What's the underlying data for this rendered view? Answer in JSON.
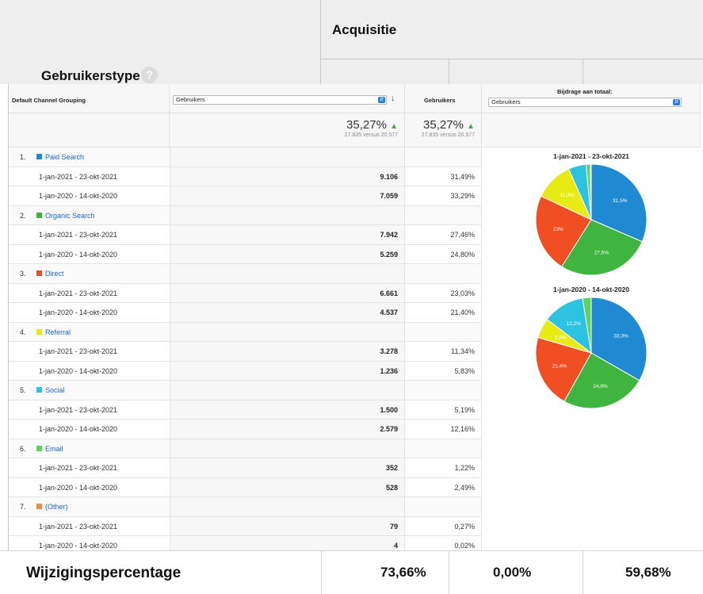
{
  "header": {
    "acquisitie": "Acquisitie",
    "gebruikerstype": "Gebruikerstype",
    "help_icon": "?"
  },
  "table": {
    "col_dimension": "Default Channel Grouping",
    "col_metric_select": "Gebruikers",
    "col_metric_header": "Gebruikers",
    "contribution_label": "Bijdrage aan totaal:",
    "contribution_select": "Gebruikers",
    "summary": [
      {
        "pct": "35,27%",
        "sub": "27.835 versus 20.577"
      },
      {
        "pct": "35,27%",
        "sub": "27.835 versus 20.577"
      }
    ],
    "groups": [
      {
        "num": "1.",
        "name": "Paid Search",
        "color": "#1f8ad1",
        "rows": [
          {
            "date": "1-jan-2021 - 23-okt-2021",
            "value": "9.106",
            "pct": "31,49%"
          },
          {
            "date": "1-jan-2020 - 14-okt-2020",
            "value": "7.059",
            "pct": "33,29%"
          }
        ]
      },
      {
        "num": "2.",
        "name": "Organic Search",
        "color": "#3fb53f",
        "rows": [
          {
            "date": "1-jan-2021 - 23-okt-2021",
            "value": "7.942",
            "pct": "27,46%"
          },
          {
            "date": "1-jan-2020 - 14-okt-2020",
            "value": "5.259",
            "pct": "24,80%"
          }
        ]
      },
      {
        "num": "3.",
        "name": "Direct",
        "color": "#f04e23",
        "rows": [
          {
            "date": "1-jan-2021 - 23-okt-2021",
            "value": "6.661",
            "pct": "23,03%"
          },
          {
            "date": "1-jan-2020 - 14-okt-2020",
            "value": "4.537",
            "pct": "21,40%"
          }
        ]
      },
      {
        "num": "4.",
        "name": "Referral",
        "color": "#e8ea13",
        "rows": [
          {
            "date": "1-jan-2021 - 23-okt-2021",
            "value": "3.278",
            "pct": "11,34%"
          },
          {
            "date": "1-jan-2020 - 14-okt-2020",
            "value": "1.236",
            "pct": "5,83%"
          }
        ]
      },
      {
        "num": "5.",
        "name": "Social",
        "color": "#2dc3e0",
        "rows": [
          {
            "date": "1-jan-2021 - 23-okt-2021",
            "value": "1.500",
            "pct": "5,19%"
          },
          {
            "date": "1-jan-2020 - 14-okt-2020",
            "value": "2.579",
            "pct": "12,16%"
          }
        ]
      },
      {
        "num": "6.",
        "name": "Email",
        "color": "#5fd35f",
        "rows": [
          {
            "date": "1-jan-2021 - 23-okt-2021",
            "value": "352",
            "pct": "1,22%"
          },
          {
            "date": "1-jan-2020 - 14-okt-2020",
            "value": "528",
            "pct": "2,49%"
          }
        ]
      },
      {
        "num": "7.",
        "name": "(Other)",
        "color": "#f08c4e",
        "rows": [
          {
            "date": "1-jan-2021 - 23-okt-2021",
            "value": "79",
            "pct": "0,27%"
          },
          {
            "date": "1-jan-2020 - 14-okt-2020",
            "value": "4",
            "pct": "0,02%"
          }
        ]
      }
    ]
  },
  "chart_data": [
    {
      "type": "pie",
      "title": "1-jan-2021 - 23-okt-2021",
      "categories": [
        "Paid Search",
        "Organic Search",
        "Direct",
        "Referral",
        "Social",
        "Email",
        "(Other)"
      ],
      "values": [
        31.49,
        27.46,
        23.03,
        11.34,
        5.19,
        1.22,
        0.27
      ],
      "colors": [
        "#1f8ad1",
        "#3fb53f",
        "#f04e23",
        "#e8ea13",
        "#2dc3e0",
        "#5fd35f",
        "#f08c4e"
      ],
      "labels": [
        "31,5%",
        "27,5%",
        "23%",
        "11,3%",
        "",
        "",
        ""
      ]
    },
    {
      "type": "pie",
      "title": "1-jan-2020 - 14-okt-2020",
      "categories": [
        "Paid Search",
        "Organic Search",
        "Direct",
        "Referral",
        "Social",
        "Email",
        "(Other)"
      ],
      "values": [
        33.29,
        24.8,
        21.4,
        5.83,
        12.16,
        2.49,
        0.02
      ],
      "colors": [
        "#1f8ad1",
        "#3fb53f",
        "#f04e23",
        "#e8ea13",
        "#2dc3e0",
        "#5fd35f",
        "#f08c4e"
      ],
      "labels": [
        "33,3%",
        "24,8%",
        "21,4%",
        "5,8%",
        "12,2%",
        "",
        ""
      ]
    }
  ],
  "footer": {
    "label": "Wijzigingspercentage",
    "values": [
      "73,66%",
      "0,00%",
      "59,68%"
    ]
  }
}
